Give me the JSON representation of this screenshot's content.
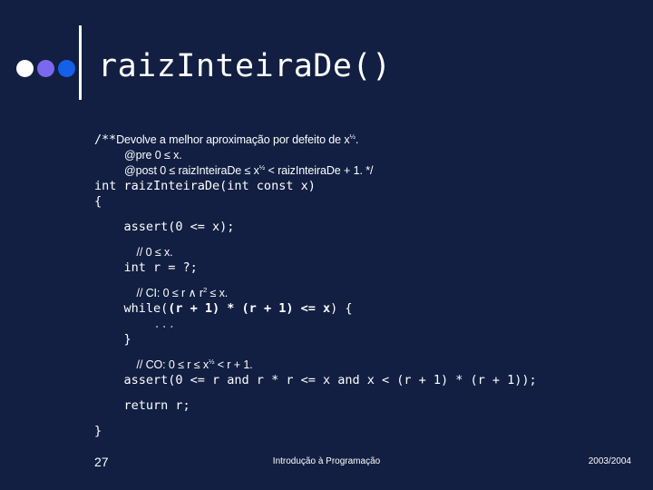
{
  "slide": {
    "background_color": "#121F42",
    "text_color": "#FFFFFF"
  },
  "header": {
    "title": "raizInteiraDe()",
    "bullets": [
      {
        "name": "bullet-dot-white",
        "color": "#FFFFFF"
      },
      {
        "name": "bullet-dot-purple",
        "color": "#7B68EE"
      },
      {
        "name": "bullet-dot-blue",
        "color": "#1560E8"
      }
    ]
  },
  "code": {
    "doc_line_1_prefix": "/**",
    "doc_line_1": "Devolve a melhor aproximação por defeito de x",
    "doc_line_1_sup": "½",
    "doc_line_1_end": ".",
    "doc_line_2": "@pre 0 ≤ x.",
    "doc_line_3_a": "@post 0 ≤ raizInteiraDe ≤ x",
    "doc_line_3_sup": "½",
    "doc_line_3_b": " < raizInteiraDe + 1. */",
    "signature": "int raizInteiraDe(int const x)",
    "open_brace": "{",
    "assert_pre": "    assert(0 <= x);",
    "comment_zero_le_x": "    // 0 ≤ x.",
    "decl_r": "    int r = ?;",
    "comment_ci_a": "    // CI: 0 ≤ r ∧ r",
    "comment_ci_sup": "2",
    "comment_ci_b": " ≤ x.",
    "while_head_a": "    while(",
    "while_head_bold": "(r + 1) * (r + 1) <= x",
    "while_head_b": ") {",
    "while_body": "        ...",
    "close_brace_inner": "    }",
    "comment_co_a": "    // CO: 0 ≤ r ≤ x",
    "comment_co_sup": "½",
    "comment_co_b": " < r + 1.",
    "assert_post": "    assert(0 <= r and r * r <= x and x < (r + 1) * (r + 1));",
    "return_line": "    return r;",
    "close_brace": "}"
  },
  "footer": {
    "page_number": "27",
    "course": "Introdução à Programação",
    "year": "2003/2004"
  }
}
